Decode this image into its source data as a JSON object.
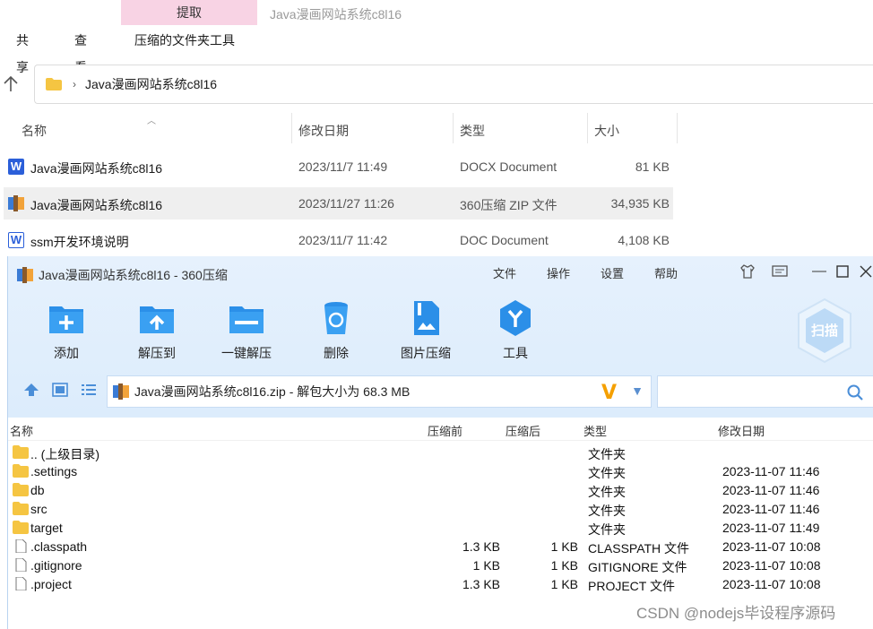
{
  "explorer": {
    "ribbon_tab_extract": "提取",
    "window_title": "Java漫画网站系统c8l16",
    "menu": [
      "共享",
      "查看",
      "压缩的文件夹工具"
    ],
    "address_path": "Java漫画网站系统c8l16",
    "columns": {
      "name": "名称",
      "date": "修改日期",
      "type": "类型",
      "size": "大小"
    },
    "files": [
      {
        "name": "Java漫画网站系统c8l16",
        "date": "2023/11/7 11:49",
        "type": "DOCX Document",
        "size": "81 KB",
        "icon": "word-docx-icon"
      },
      {
        "name": "Java漫画网站系统c8l16",
        "date": "2023/11/27 11:26",
        "type": "360压缩 ZIP 文件",
        "size": "34,935 KB",
        "icon": "zip-archive-icon"
      },
      {
        "name": "ssm开发环境说明",
        "date": "2023/11/7 11:42",
        "type": "DOC Document",
        "size": "4,108 KB",
        "icon": "word-doc-icon"
      }
    ]
  },
  "zip": {
    "title": "Java漫画网站系统c8l16 - 360压缩",
    "menus": [
      "文件",
      "操作",
      "设置",
      "帮助"
    ],
    "toolbar": [
      "添加",
      "解压到",
      "一键解压",
      "删除",
      "图片压缩",
      "工具"
    ],
    "scan_label": "扫描",
    "path_text": "Java漫画网站系统c8l16.zip - 解包大小为 68.3 MB",
    "columns": {
      "name": "名称",
      "before": "压缩前",
      "after": "压缩后",
      "type": "类型",
      "date": "修改日期"
    },
    "entries": [
      {
        "name": ".. (上级目录)",
        "before": "",
        "after": "",
        "type": "文件夹",
        "date": "",
        "kind": "folder"
      },
      {
        "name": ".settings",
        "before": "",
        "after": "",
        "type": "文件夹",
        "date": "2023-11-07 11:46",
        "kind": "folder"
      },
      {
        "name": "db",
        "before": "",
        "after": "",
        "type": "文件夹",
        "date": "2023-11-07 11:46",
        "kind": "folder"
      },
      {
        "name": "src",
        "before": "",
        "after": "",
        "type": "文件夹",
        "date": "2023-11-07 11:46",
        "kind": "folder"
      },
      {
        "name": "target",
        "before": "",
        "after": "",
        "type": "文件夹",
        "date": "2023-11-07 11:49",
        "kind": "folder"
      },
      {
        "name": ".classpath",
        "before": "1.3 KB",
        "after": "1 KB",
        "type": "CLASSPATH 文件",
        "date": "2023-11-07 10:08",
        "kind": "file"
      },
      {
        "name": ".gitignore",
        "before": "1 KB",
        "after": "1 KB",
        "type": "GITIGNORE 文件",
        "date": "2023-11-07 10:08",
        "kind": "file"
      },
      {
        "name": ".project",
        "before": "1.3 KB",
        "after": "1 KB",
        "type": "PROJECT 文件",
        "date": "2023-11-07 10:08",
        "kind": "file"
      }
    ]
  },
  "watermark": "CSDN @nodejs毕设程序源码",
  "colors": {
    "accent_blue": "#2b8fe8",
    "ribbon_pink": "#f8d3e4",
    "zip_bg": "#dcecfc",
    "folder_yellow": "#f5c542"
  }
}
